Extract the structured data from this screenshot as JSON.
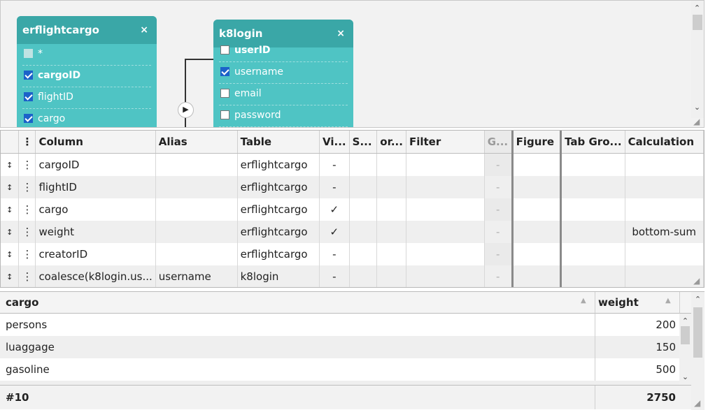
{
  "diagram": {
    "tables": [
      {
        "name": "erflightcargo",
        "close": "×",
        "rows": [
          {
            "label": "*",
            "checked": "gray"
          },
          {
            "label": "cargoID",
            "checked": "on",
            "bold": true
          },
          {
            "label": "flightID",
            "checked": "on"
          },
          {
            "label": "cargo",
            "checked": "on"
          }
        ]
      },
      {
        "name": "k8login",
        "close": "×",
        "rows": [
          {
            "label": "userID",
            "checked": "off",
            "bold": true
          },
          {
            "label": "username",
            "checked": "on"
          },
          {
            "label": "email",
            "checked": "off"
          },
          {
            "label": "password",
            "checked": "off"
          }
        ]
      }
    ],
    "run_glyph": "▶"
  },
  "grid": {
    "columns": [
      "",
      "⋮",
      "Column",
      "Alias",
      "Table",
      "Vi...",
      "S...",
      "or...",
      "Filter",
      "G...",
      "Figure",
      "Tab Gro...",
      "Calculation"
    ],
    "rows": [
      [
        "↕",
        "⋮",
        "cargoID",
        "",
        "erflightcargo",
        "-",
        "",
        "",
        "",
        "-",
        "",
        "",
        ""
      ],
      [
        "↕",
        "⋮",
        "flightID",
        "",
        "erflightcargo",
        "-",
        "",
        "",
        "",
        "-",
        "",
        "",
        ""
      ],
      [
        "↕",
        "⋮",
        "cargo",
        "",
        "erflightcargo",
        "✓",
        "",
        "",
        "",
        "-",
        "",
        "",
        ""
      ],
      [
        "↕",
        "⋮",
        "weight",
        "",
        "erflightcargo",
        "✓",
        "",
        "",
        "",
        "-",
        "",
        "",
        "bottom-sum"
      ],
      [
        "↕",
        "⋮",
        "creatorID",
        "",
        "erflightcargo",
        "-",
        "",
        "",
        "",
        "-",
        "",
        "",
        ""
      ],
      [
        "↕",
        "⋮",
        "coalesce(k8login.us...",
        "username",
        "k8login",
        "-",
        "",
        "",
        "",
        "-",
        "",
        "",
        ""
      ]
    ]
  },
  "results": {
    "headers": {
      "cargo": "cargo",
      "weight": "weight"
    },
    "rows": [
      {
        "cargo": "persons",
        "weight": "200"
      },
      {
        "cargo": "luaggage",
        "weight": "150"
      },
      {
        "cargo": "gasoline",
        "weight": "500"
      }
    ],
    "footer": {
      "count": "#10",
      "total": "2750"
    }
  },
  "icons": {
    "up": "⌃",
    "down": "⌄",
    "sort": "▲",
    "grip": "◢"
  }
}
